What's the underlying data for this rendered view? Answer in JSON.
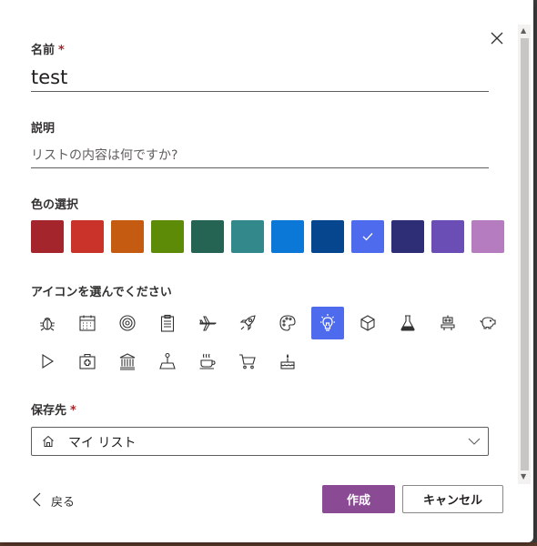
{
  "name": {
    "label": "名前",
    "required": "*",
    "value": "test"
  },
  "description": {
    "label": "説明",
    "placeholder": "リストの内容は何ですか?",
    "value": ""
  },
  "color": {
    "label": "色の選択",
    "selected_index": 8,
    "swatches": [
      "#a4262c",
      "#ca3329",
      "#c55a11",
      "#5d8b07",
      "#256352",
      "#33888c",
      "#0b78d8",
      "#05468e",
      "#4f6bed",
      "#2e2e77",
      "#6b4eb5",
      "#b57cbf"
    ]
  },
  "icon": {
    "label": "アイコンを選んでください",
    "selected": "lightbulb-icon",
    "items": [
      "bug-icon",
      "calendar-icon",
      "target-icon",
      "clipboard-icon",
      "airplane-icon",
      "rocket-icon",
      "palette-icon",
      "lightbulb-icon",
      "cube-icon",
      "flask-icon",
      "robot-icon",
      "piggy-bank-icon",
      "play-icon",
      "first-aid-kit-icon",
      "bank-icon",
      "joystick-icon",
      "coffee-cup-icon",
      "shopping-cart-icon",
      "cake-icon"
    ]
  },
  "save_location": {
    "label": "保存先",
    "required": "*",
    "value": "マイ リスト"
  },
  "footer": {
    "back_label": "戻る",
    "create_label": "作成",
    "cancel_label": "キャンセル"
  },
  "colors": {
    "primary_button": "#8b4a94",
    "selected_icon_bg": "#4f6bed",
    "required": "#a4262c"
  }
}
